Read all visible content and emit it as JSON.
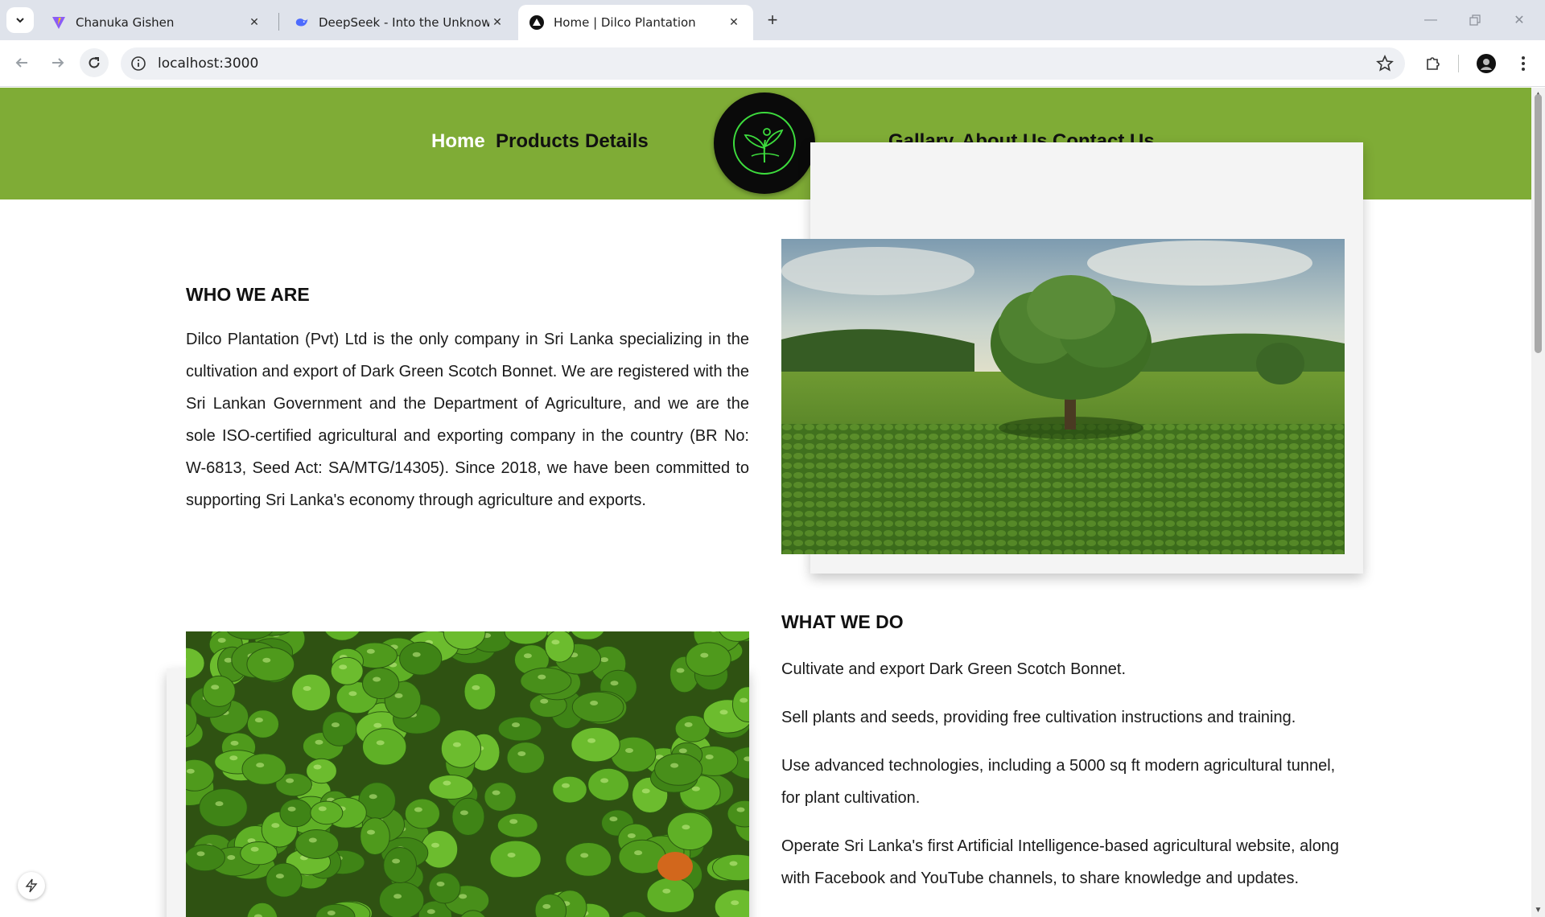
{
  "browser": {
    "tabs": [
      {
        "title": "Chanuka Gishen",
        "active": false
      },
      {
        "title": "DeepSeek - Into the Unknown",
        "active": false
      },
      {
        "title": "Home | Dilco Plantation",
        "active": true
      }
    ],
    "new_tab": "+",
    "url": "localhost:3000"
  },
  "site": {
    "nav_left": [
      "Home",
      "Products",
      "Details"
    ],
    "nav_right": [
      "Gallary",
      "About Us",
      "Contact Us"
    ],
    "accent_color": "#7fac36",
    "logo_icon": "plant-sprout-logo"
  },
  "who_we_are": {
    "title": "WHO WE ARE",
    "body": "Dilco Plantation (Pvt) Ltd is the only company in Sri Lanka specializing in the cultivation and export of Dark Green Scotch Bonnet. We are registered with the Sri Lankan Government and the Department of Agriculture, and we are the sole ISO-certified agricultural and exporting company in the country (BR No: W-6813, Seed Act: SA/MTG/14305). Since 2018, we have been committed to supporting Sri Lanka's economy through agriculture and exports."
  },
  "what_we_do": {
    "title": "WHAT WE DO",
    "items": [
      "Cultivate and export Dark Green Scotch Bonnet.",
      "Sell plants and seeds, providing free cultivation instructions and training.",
      "Use advanced technologies, including a 5000 sq ft modern agricultural tunnel, for plant cultivation.",
      "Operate Sri Lanka's first Artificial Intelligence-based agricultural website, along with Facebook and YouTube channels, to share knowledge and updates."
    ]
  }
}
